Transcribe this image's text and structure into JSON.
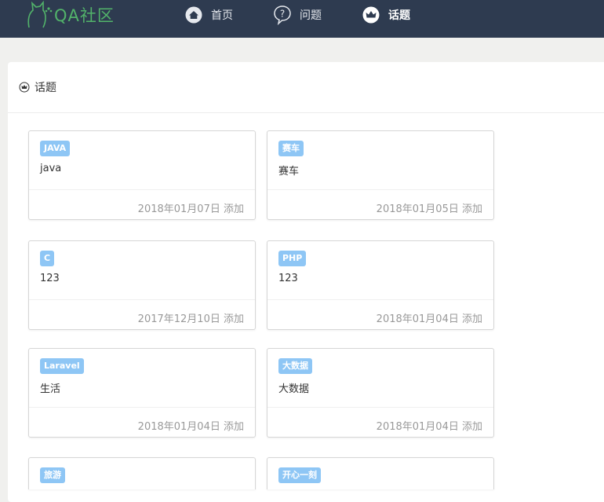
{
  "brand": {
    "name": "QA社区"
  },
  "nav": [
    {
      "label": "首页",
      "icon": "home-icon"
    },
    {
      "label": "问题",
      "icon": "question-icon"
    },
    {
      "label": "话题",
      "icon": "crown-icon",
      "active": true
    }
  ],
  "page": {
    "title": "话题",
    "title_icon": "crown-icon"
  },
  "topics": [
    {
      "tag": "JAVA",
      "desc": "java",
      "date": "2018年01月07日",
      "action": "添加"
    },
    {
      "tag": "赛车",
      "desc": "赛车",
      "date": "2018年01月05日",
      "action": "添加"
    },
    {
      "tag": "C",
      "desc": "123",
      "date": "2017年12月10日",
      "action": "添加"
    },
    {
      "tag": "PHP",
      "desc": "123",
      "date": "2018年01月04日",
      "action": "添加"
    },
    {
      "tag": "Laravel",
      "desc": "生活",
      "date": "2018年01月04日",
      "action": "添加"
    },
    {
      "tag": "大数据",
      "desc": "大数据",
      "date": "2018年01月04日",
      "action": "添加"
    },
    {
      "tag": "旅游",
      "desc": "",
      "date": "",
      "action": ""
    },
    {
      "tag": "开心一刻",
      "desc": "",
      "date": "",
      "action": ""
    }
  ],
  "colors": {
    "navbar": "#2e3b50",
    "brand": "#52b36a",
    "tag_bg": "#8ec6f5"
  }
}
